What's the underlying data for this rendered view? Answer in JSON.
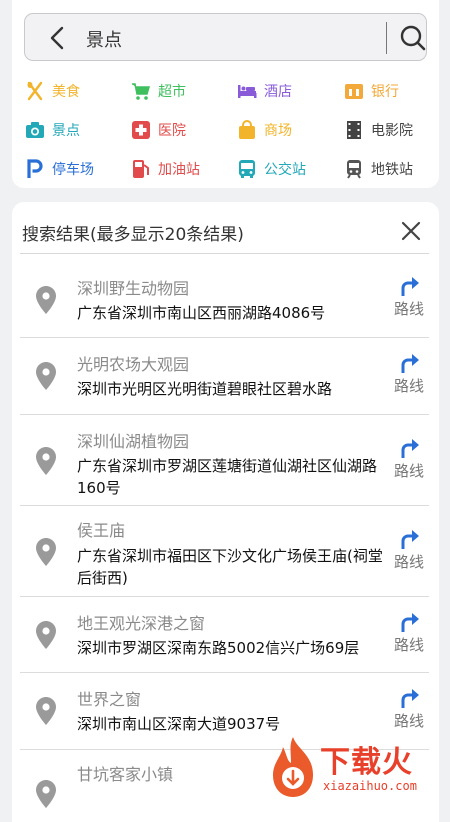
{
  "search": {
    "query": "景点"
  },
  "categories": [
    {
      "label": "美食",
      "icon": "food-icon",
      "color": "#f2b42a"
    },
    {
      "label": "超市",
      "icon": "cart-icon",
      "color": "#3fbf5e"
    },
    {
      "label": "酒店",
      "icon": "hotel-icon",
      "color": "#8a5bd8"
    },
    {
      "label": "银行",
      "icon": "bank-icon",
      "color": "#f2a93a"
    },
    {
      "label": "景点",
      "icon": "camera-icon",
      "color": "#23a8b8"
    },
    {
      "label": "医院",
      "icon": "hospital-icon",
      "color": "#e24b4b"
    },
    {
      "label": "商场",
      "icon": "shopping-bag-icon",
      "color": "#f2b42a"
    },
    {
      "label": "电影院",
      "icon": "film-icon",
      "color": "#444444"
    },
    {
      "label": "停车场",
      "icon": "parking-icon",
      "color": "#2a6fd8"
    },
    {
      "label": "加油站",
      "icon": "fuel-icon",
      "color": "#e24b4b"
    },
    {
      "label": "公交站",
      "icon": "bus-icon",
      "color": "#23a8b8"
    },
    {
      "label": "地铁站",
      "icon": "subway-icon",
      "color": "#444444"
    }
  ],
  "results": {
    "header": "搜索结果(最多显示20条结果)",
    "route_label": "路线",
    "items": [
      {
        "name": "深圳野生动物园",
        "address": "广东省深圳市南山区西丽湖路4086号"
      },
      {
        "name": "光明农场大观园",
        "address": "深圳市光明区光明街道碧眼社区碧水路"
      },
      {
        "name": "深圳仙湖植物园",
        "address": "广东省深圳市罗湖区莲塘街道仙湖社区仙湖路160号"
      },
      {
        "name": "侯王庙",
        "address": "广东省深圳市福田区下沙文化广场侯王庙(祠堂后街西)"
      },
      {
        "name": "地王观光深港之窗",
        "address": "深圳市罗湖区深南东路5002信兴广场69层"
      },
      {
        "name": "世界之窗",
        "address": "深圳市南山区深南大道9037号"
      },
      {
        "name": "甘坑客家小镇",
        "address": ""
      }
    ]
  },
  "watermark": {
    "text": "下载火",
    "url": "xiazaihuo.com"
  },
  "colors": {
    "route_blue": "#2a6fd8",
    "pin_gray": "#9a9a9a"
  }
}
